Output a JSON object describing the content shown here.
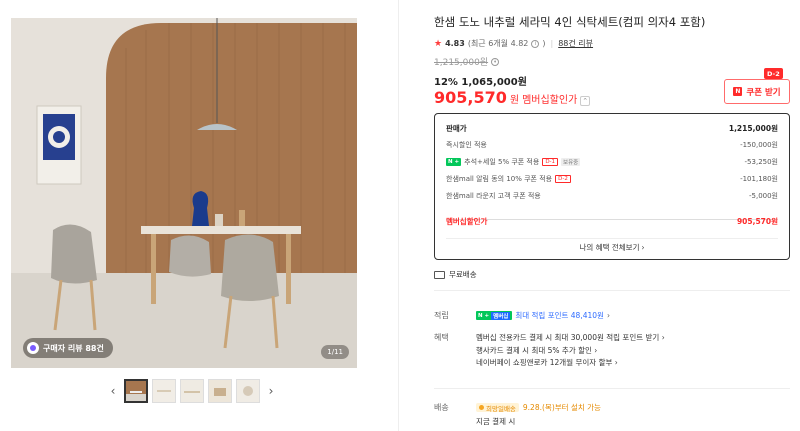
{
  "gallery": {
    "review_chip": "구매자 리뷰 88건",
    "counter": "1/11",
    "prev_icon": "chevron-left-icon",
    "next_icon": "chevron-right-icon",
    "thumb_count": 5
  },
  "product": {
    "title": "한샘 도노 내추럴 세라믹 4인 식탁세트(컴피 의자4 포함)",
    "rating": "4.83",
    "recent_rating": "(최근 6개월 4.82",
    "review_count": "88건 리뷰",
    "original_price": "1,215,000원",
    "sale_discount": "12% 1,065,000원",
    "member_price": "905,570",
    "member_won": "원",
    "member_label": "멤버십할인가",
    "coupon_button": "쿠폰 받기",
    "coupon_badge": "D-2"
  },
  "breakdown": {
    "head_label": "판매가",
    "head_value": "1,215,000원",
    "rows": [
      {
        "label": "즉시할인 적용",
        "value": "-150,000원"
      },
      {
        "label": "추석+세일 5% 쿠폰 적용",
        "tag": "D-1",
        "hold": "보유중",
        "value": "-53,250원"
      },
      {
        "label": "한샘mall 알림 동의 10% 쿠폰 적용",
        "tag": "D-2",
        "value": "-101,180원"
      },
      {
        "label": "한샘mall 라운지 고객 쿠폰 적용",
        "value": "-5,000원"
      }
    ],
    "total_label": "멤버십할인가",
    "total_value": "905,570원",
    "all_benefits": "나의 혜택 전체보기"
  },
  "shipping_free": "무료배송",
  "points": {
    "label": "적립",
    "text": "최대 적립 포인트 48,410원"
  },
  "benefits": {
    "label": "혜택",
    "items": [
      "멤버십 전용카드 결제 시 최대 30,000원 적립 포인트 받기",
      "행사카드 결제 시 최대 5% 추가 할인",
      "네이버페이 쇼핑앤로카 12개월 무이자 할부"
    ]
  },
  "delivery": {
    "label": "배송",
    "tag": "희망일배송",
    "date": "9.28.(목)부터 설치 가능",
    "pay": "지금 결제 시"
  },
  "colors": {
    "accent_red": "#ff2a2a",
    "naver_green": "#03c75a",
    "link_blue": "#2f6cff"
  }
}
